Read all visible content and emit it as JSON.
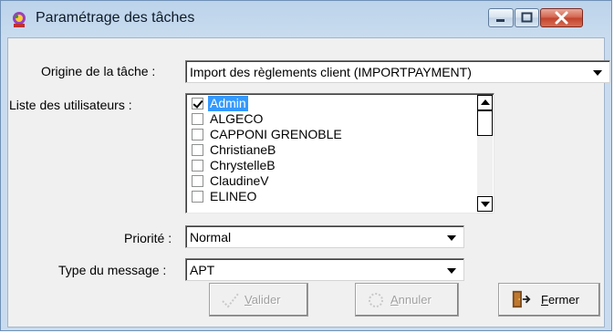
{
  "window": {
    "title": "Paramétrage des tâches",
    "icons": {
      "app": "task-settings-icon",
      "minimize": "minimize-icon",
      "maximize": "maximize-icon",
      "close": "close-icon"
    }
  },
  "form": {
    "origin": {
      "label": "Origine de la tâche :",
      "value": "Import des règlements client (IMPORTPAYMENT)"
    },
    "users": {
      "label": "Liste des utilisateurs :",
      "items": [
        {
          "name": "Admin",
          "checked": true,
          "selected": true
        },
        {
          "name": "ALGECO",
          "checked": false,
          "selected": false
        },
        {
          "name": "CAPPONI GRENOBLE",
          "checked": false,
          "selected": false
        },
        {
          "name": "ChristianeB",
          "checked": false,
          "selected": false
        },
        {
          "name": "ChrystelleB",
          "checked": false,
          "selected": false
        },
        {
          "name": "ClaudineV",
          "checked": false,
          "selected": false
        },
        {
          "name": "ELINEO",
          "checked": false,
          "selected": false
        }
      ]
    },
    "priority": {
      "label": "Priorité :",
      "value": "Normal"
    },
    "message_type": {
      "label": "Type du message :",
      "value": "APT"
    }
  },
  "buttons": {
    "validate": {
      "mnemonic": "V",
      "rest": "alider",
      "enabled": false,
      "icon": "validate-icon"
    },
    "cancel": {
      "mnemonic": "A",
      "rest": "nnuler",
      "enabled": false,
      "icon": "cancel-icon"
    },
    "close": {
      "mnemonic": "F",
      "rest": "ermer",
      "enabled": true,
      "icon": "exit-door-icon"
    }
  },
  "colors": {
    "selection": "#3399ff",
    "titlebar": "#bcd3ea",
    "close_button": "#c2432c"
  }
}
